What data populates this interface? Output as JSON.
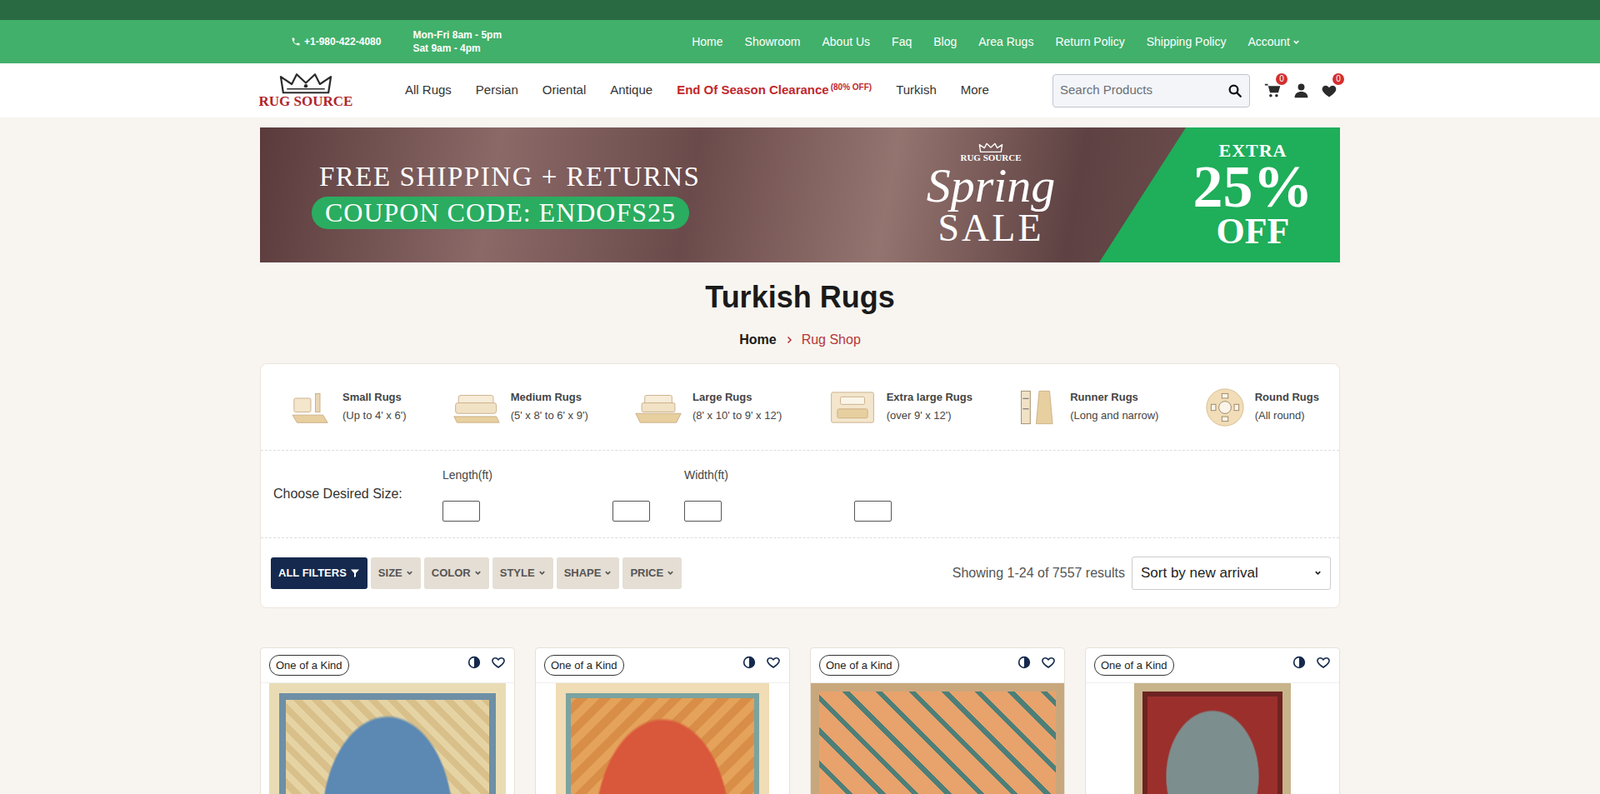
{
  "top_bar": {
    "phone": "+1-980-422-4080",
    "hours": [
      "Mon-Fri 8am - 5pm",
      "Sat 9am - 4pm"
    ],
    "links": [
      {
        "label": "Home",
        "kind": "link"
      },
      {
        "label": "Showroom",
        "kind": "link"
      },
      {
        "label": "About Us",
        "kind": "link"
      },
      {
        "label": "Faq",
        "kind": "link"
      },
      {
        "label": "Blog",
        "kind": "link"
      },
      {
        "label": "Area Rugs",
        "kind": "link"
      },
      {
        "label": "Return Policy",
        "kind": "link"
      },
      {
        "label": "Shipping Policy",
        "kind": "link"
      },
      {
        "label": "Account",
        "kind": "menu"
      }
    ]
  },
  "header": {
    "logo": "RUG SOURCE",
    "nav": [
      {
        "label": "All Rugs",
        "kind": "link"
      },
      {
        "label": "Persian",
        "kind": "link"
      },
      {
        "label": "Oriental",
        "kind": "link"
      },
      {
        "label": "Antique",
        "kind": "link"
      },
      {
        "label": "End Of Season Clearance",
        "note": "(80% OFF)",
        "kind": "promo"
      },
      {
        "label": "Turkish",
        "kind": "link"
      },
      {
        "label": "More",
        "kind": "link"
      }
    ],
    "search": {
      "placeholder": "Search Products"
    },
    "cart_count": "0",
    "wishlist_count": "0"
  },
  "banner": {
    "line1": "FREE SHIPPING + RETURNS",
    "coupon": "COUPON CODE: ENDOFS25",
    "brand": "RUG SOURCE",
    "script": "Spring",
    "sale": "SALE",
    "extra": "EXTRA",
    "percent": "25%",
    "off": "OFF"
  },
  "page": {
    "title": "Turkish Rugs",
    "breadcrumb": [
      {
        "label": "Home",
        "selected": false
      },
      {
        "label": "Rug Shop",
        "selected": true
      }
    ]
  },
  "size_categories": [
    {
      "name": "Small Rugs",
      "range": "(Up to 4' x 6')"
    },
    {
      "name": "Medium Rugs",
      "range": "(5' x 8' to 6' x 9')"
    },
    {
      "name": "Large Rugs",
      "range": "(8' x 10' to 9' x 12')"
    },
    {
      "name": "Extra large Rugs",
      "range": "(over 9' x 12')"
    },
    {
      "name": "Runner Rugs",
      "range": "(Long and narrow)"
    },
    {
      "name": "Round Rugs",
      "range": "(All round)"
    }
  ],
  "size_picker": {
    "label": "Choose Desired Size:",
    "fields": [
      {
        "label": "Length(ft)"
      },
      {
        "label": "Width(ft)"
      }
    ]
  },
  "filters": [
    {
      "label": "ALL FILTERS",
      "kind": "all"
    },
    {
      "label": "SIZE",
      "kind": "dropdown"
    },
    {
      "label": "COLOR",
      "kind": "dropdown"
    },
    {
      "label": "STYLE",
      "kind": "dropdown"
    },
    {
      "label": "SHAPE",
      "kind": "dropdown"
    },
    {
      "label": "PRICE",
      "kind": "dropdown"
    }
  ],
  "results": "Showing 1-24 of 7557 results",
  "sort": {
    "value": "Sort by new arrival"
  },
  "products": [
    {
      "tag": "One of a Kind",
      "wishlisted": false
    },
    {
      "tag": "One of a Kind",
      "wishlisted": false
    },
    {
      "tag": "One of a Kind",
      "wishlisted": false
    },
    {
      "tag": "One of a Kind",
      "wishlisted": false
    }
  ]
}
